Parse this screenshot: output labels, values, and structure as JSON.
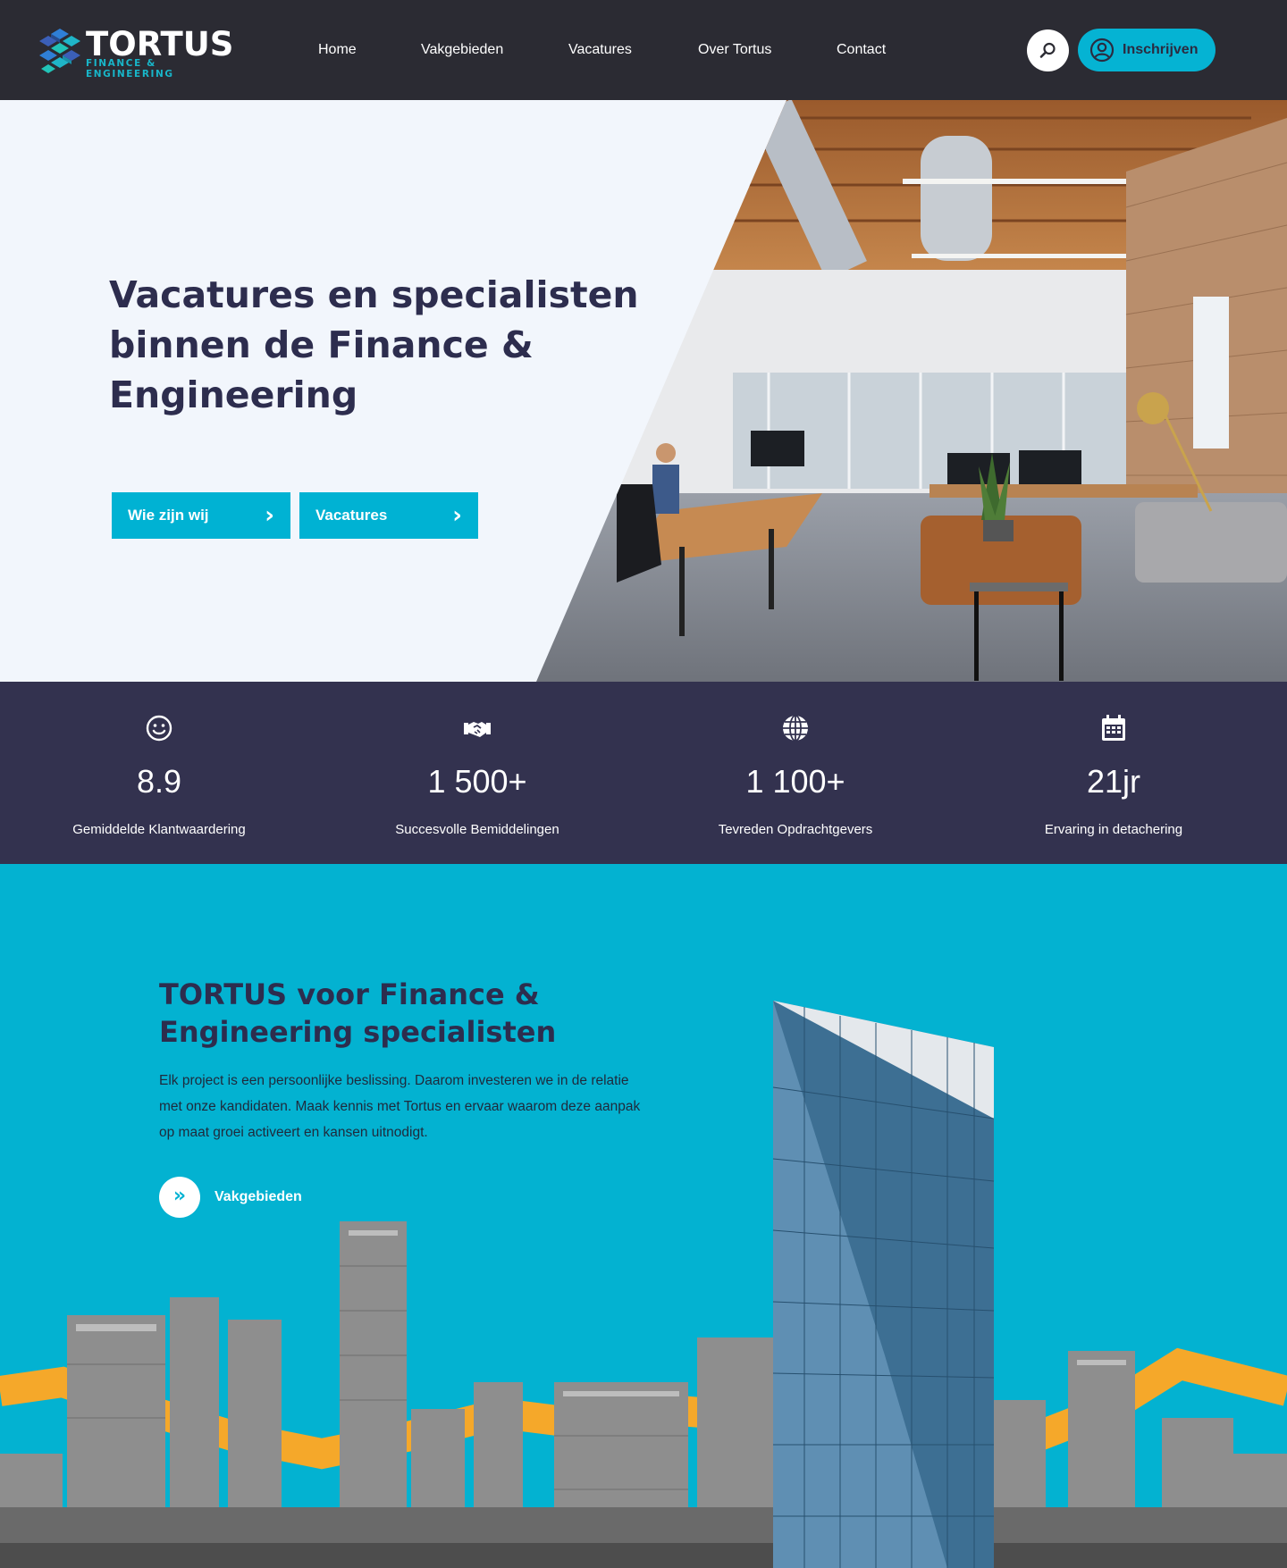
{
  "header": {
    "logo": {
      "name": "TORTUS",
      "tagline": "FINANCE & ENGINEERING"
    },
    "nav": [
      {
        "label": "Home"
      },
      {
        "label": "Vakgebieden"
      },
      {
        "label": "Vacatures"
      },
      {
        "label": "Over Tortus"
      },
      {
        "label": "Contact"
      }
    ],
    "search_icon": "search-icon",
    "signup": {
      "label": "Inschrijven",
      "icon": "user-circle-icon"
    }
  },
  "hero": {
    "title": "Vacatures en specialisten binnen de Finance & Engineering",
    "buttons": [
      {
        "label": "Wie zijn wij",
        "icon": "chevron-right-icon"
      },
      {
        "label": "Vacatures",
        "icon": "chevron-right-icon"
      }
    ]
  },
  "stats": [
    {
      "icon": "smiley-icon",
      "value": "8.9",
      "label": "Gemiddelde Klantwaardering"
    },
    {
      "icon": "handshake-icon",
      "value": "1 500+",
      "label": "Succesvolle Bemiddelingen"
    },
    {
      "icon": "globe-icon",
      "value": "1 100+",
      "label": "Tevreden Opdrachtgevers"
    },
    {
      "icon": "calendar-icon",
      "value": "21jr",
      "label": "Ervaring in detachering"
    }
  ],
  "about": {
    "title": "TORTUS voor Finance & Engineering specialisten",
    "text": "Elk project is een persoonlijke beslissing. Daarom investeren we in de relatie met onze kandidaten. Maak kennis met Tortus en ervaar waarom deze aanpak op maat groei activeert en kansen uitnodigt.",
    "link": {
      "label": "Vakgebieden",
      "icon": "double-chevron-right-icon"
    }
  },
  "colors": {
    "header_bg": "#2b2b33",
    "accent": "#05b3d3",
    "navy": "#33324f",
    "title": "#2d2d4e",
    "hero_bg": "#f2f6fc",
    "orange": "#f5a82a"
  }
}
